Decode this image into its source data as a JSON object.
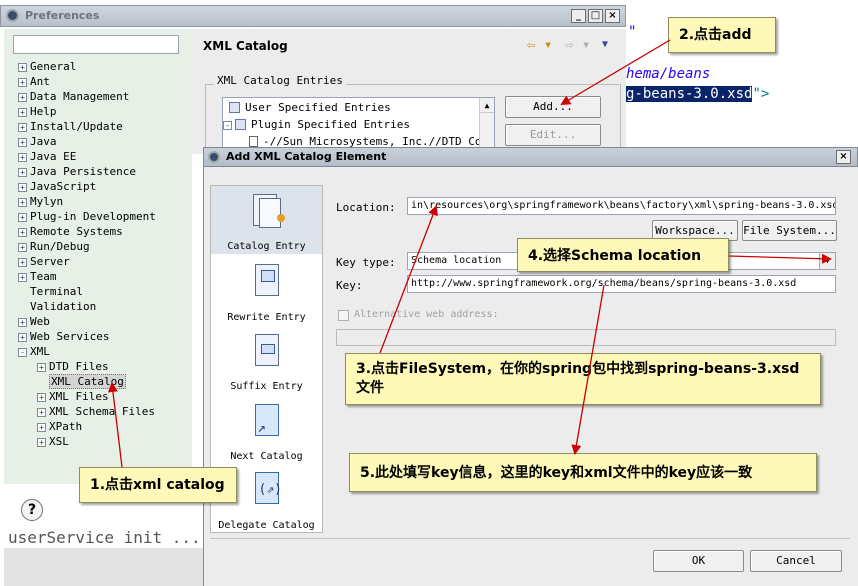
{
  "editor": {
    "line1": "\"",
    "line2": "hema/beans",
    "line3_selected": "g-beans-3.0.xsd",
    "line3_end": "\">",
    "bottom_snippet": "userService init ..."
  },
  "preferences": {
    "title": "Preferences",
    "filter_value": "",
    "panel_title": "XML Catalog",
    "group_label": "XML Catalog Entries",
    "entries": [
      "User Specified Entries",
      "Plugin Specified Entries",
      "-//Sun Microsystems, Inc.//DTD Co"
    ],
    "add_label": "Add...",
    "edit_label": "Edit...",
    "help_symbol": "?",
    "tree": [
      {
        "label": "General",
        "exp": "+"
      },
      {
        "label": "Ant",
        "exp": "+"
      },
      {
        "label": "Data Management",
        "exp": "+"
      },
      {
        "label": "Help",
        "exp": "+"
      },
      {
        "label": "Install/Update",
        "exp": "+"
      },
      {
        "label": "Java",
        "exp": "+"
      },
      {
        "label": "Java EE",
        "exp": "+"
      },
      {
        "label": "Java Persistence",
        "exp": "+"
      },
      {
        "label": "JavaScript",
        "exp": "+"
      },
      {
        "label": "Mylyn",
        "exp": "+"
      },
      {
        "label": "Plug-in Development",
        "exp": "+"
      },
      {
        "label": "Remote Systems",
        "exp": "+"
      },
      {
        "label": "Run/Debug",
        "exp": "+"
      },
      {
        "label": "Server",
        "exp": "+"
      },
      {
        "label": "Team",
        "exp": "+"
      },
      {
        "label": "Terminal",
        "exp": ""
      },
      {
        "label": "Validation",
        "exp": ""
      },
      {
        "label": "Web",
        "exp": "+"
      },
      {
        "label": "Web Services",
        "exp": "+"
      },
      {
        "label": "XML",
        "exp": "-"
      },
      {
        "label": "DTD Files",
        "exp": "+",
        "child": true
      },
      {
        "label": "XML Catalog",
        "exp": "",
        "child": true,
        "selected": true
      },
      {
        "label": "XML Files",
        "exp": "+",
        "child": true
      },
      {
        "label": "XML Schema Files",
        "exp": "+",
        "child": true
      },
      {
        "label": "XPath",
        "exp": "+",
        "child": true
      },
      {
        "label": "XSL",
        "exp": "+",
        "child": true
      }
    ]
  },
  "dialog": {
    "title": "Add XML Catalog Element",
    "close_symbol": "×",
    "side_items": [
      "Catalog Entry",
      "Rewrite Entry",
      "Suffix Entry",
      "Next Catalog",
      "Delegate Catalog"
    ],
    "location_label": "Location:",
    "location_value": "in\\resources\\org\\springframework\\beans\\factory\\xml\\spring-beans-3.0.xsd",
    "workspace_label": "Workspace...",
    "filesystem_label": "File System...",
    "keytype_label": "Key type:",
    "keytype_value": "Schema location",
    "key_label": "Key:",
    "key_value": "http://www.springframework.org/schema/beans/spring-beans-3.0.xsd",
    "alt_label": "Alternative web address:",
    "ok_label": "OK",
    "cancel_label": "Cancel"
  },
  "annotations": {
    "step1": "1.点击xml catalog",
    "step2": "2.点击add",
    "step3": "3.点击FileSystem，在你的spring包中找到spring-beans-3.xsd文件",
    "step4": "4.选择Schema location",
    "step5": "5.此处填写key信息，这里的key和xml文件中的key应该一致"
  },
  "colors": {
    "callout_bg": "#fff9b9",
    "arrow": "#cc0000",
    "selection": "#0a246a"
  }
}
